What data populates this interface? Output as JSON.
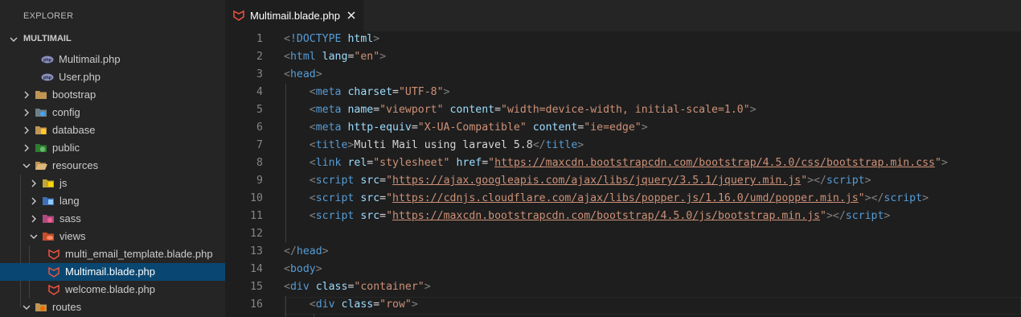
{
  "sidebar": {
    "title": "EXPLORER",
    "section": "MULTIMAIL",
    "items": [
      {
        "label": "Multimail.php",
        "icon": "php-file-icon"
      },
      {
        "label": "User.php",
        "icon": "php-file-icon"
      },
      {
        "label": "bootstrap",
        "icon": "folder-icon"
      },
      {
        "label": "config",
        "icon": "config-folder-icon"
      },
      {
        "label": "database",
        "icon": "database-folder-icon"
      },
      {
        "label": "public",
        "icon": "public-folder-icon"
      },
      {
        "label": "resources",
        "icon": "folder-open-icon"
      },
      {
        "label": "js",
        "icon": "js-folder-icon"
      },
      {
        "label": "lang",
        "icon": "lang-folder-icon"
      },
      {
        "label": "sass",
        "icon": "sass-folder-icon"
      },
      {
        "label": "views",
        "icon": "views-folder-icon"
      },
      {
        "label": "multi_email_template.blade.php",
        "icon": "blade-file-icon"
      },
      {
        "label": "Multimail.blade.php",
        "icon": "blade-file-icon"
      },
      {
        "label": "welcome.blade.php",
        "icon": "blade-file-icon"
      },
      {
        "label": "routes",
        "icon": "routes-folder-icon"
      }
    ]
  },
  "tab": {
    "label": "Multimail.blade.php"
  },
  "code": {
    "lines": [
      [
        [
          "t-punc",
          "<"
        ],
        [
          "t-tag",
          "!DOCTYPE"
        ],
        [
          "t-text",
          " "
        ],
        [
          "t-attr",
          "html"
        ],
        [
          "t-punc",
          ">"
        ]
      ],
      [
        [
          "t-punc",
          "<"
        ],
        [
          "t-tag",
          "html"
        ],
        [
          "t-text",
          " "
        ],
        [
          "t-attr",
          "lang"
        ],
        [
          "t-text",
          "="
        ],
        [
          "t-str",
          "\"en\""
        ],
        [
          "t-punc",
          ">"
        ]
      ],
      [
        [
          "t-punc",
          "<"
        ],
        [
          "t-tag",
          "head"
        ],
        [
          "t-punc",
          ">"
        ]
      ],
      [
        [
          "t-text",
          "    "
        ],
        [
          "t-punc",
          "<"
        ],
        [
          "t-tag",
          "meta"
        ],
        [
          "t-text",
          " "
        ],
        [
          "t-attr",
          "charset"
        ],
        [
          "t-text",
          "="
        ],
        [
          "t-str",
          "\"UTF-8\""
        ],
        [
          "t-punc",
          ">"
        ]
      ],
      [
        [
          "t-text",
          "    "
        ],
        [
          "t-punc",
          "<"
        ],
        [
          "t-tag",
          "meta"
        ],
        [
          "t-text",
          " "
        ],
        [
          "t-attr",
          "name"
        ],
        [
          "t-text",
          "="
        ],
        [
          "t-str",
          "\"viewport\""
        ],
        [
          "t-text",
          " "
        ],
        [
          "t-attr",
          "content"
        ],
        [
          "t-text",
          "="
        ],
        [
          "t-str",
          "\"width=device-width, initial-scale=1.0\""
        ],
        [
          "t-punc",
          ">"
        ]
      ],
      [
        [
          "t-text",
          "    "
        ],
        [
          "t-punc",
          "<"
        ],
        [
          "t-tag",
          "meta"
        ],
        [
          "t-text",
          " "
        ],
        [
          "t-attr",
          "http-equiv"
        ],
        [
          "t-text",
          "="
        ],
        [
          "t-str",
          "\"X-UA-Compatible\""
        ],
        [
          "t-text",
          " "
        ],
        [
          "t-attr",
          "content"
        ],
        [
          "t-text",
          "="
        ],
        [
          "t-str",
          "\"ie=edge\""
        ],
        [
          "t-punc",
          ">"
        ]
      ],
      [
        [
          "t-text",
          "    "
        ],
        [
          "t-punc",
          "<"
        ],
        [
          "t-tag",
          "title"
        ],
        [
          "t-punc",
          ">"
        ],
        [
          "t-text",
          "Multi Mail using laravel 5.8"
        ],
        [
          "t-punc",
          "</"
        ],
        [
          "t-tag",
          "title"
        ],
        [
          "t-punc",
          ">"
        ]
      ],
      [
        [
          "t-text",
          "    "
        ],
        [
          "t-punc",
          "<"
        ],
        [
          "t-tag",
          "link"
        ],
        [
          "t-text",
          " "
        ],
        [
          "t-attr",
          "rel"
        ],
        [
          "t-text",
          "="
        ],
        [
          "t-str",
          "\"stylesheet\""
        ],
        [
          "t-text",
          " "
        ],
        [
          "t-attr",
          "href"
        ],
        [
          "t-text",
          "="
        ],
        [
          "t-str",
          "\""
        ],
        [
          "t-str t-url",
          "https://maxcdn.bootstrapcdn.com/bootstrap/4.5.0/css/bootstrap.min.css"
        ],
        [
          "t-str",
          "\""
        ],
        [
          "t-punc",
          ">"
        ]
      ],
      [
        [
          "t-text",
          "    "
        ],
        [
          "t-punc",
          "<"
        ],
        [
          "t-tag",
          "script"
        ],
        [
          "t-text",
          " "
        ],
        [
          "t-attr",
          "src"
        ],
        [
          "t-text",
          "="
        ],
        [
          "t-str",
          "\""
        ],
        [
          "t-str t-url",
          "https://ajax.googleapis.com/ajax/libs/jquery/3.5.1/jquery.min.js"
        ],
        [
          "t-str",
          "\""
        ],
        [
          "t-punc",
          "></"
        ],
        [
          "t-tag",
          "script"
        ],
        [
          "t-punc",
          ">"
        ]
      ],
      [
        [
          "t-text",
          "    "
        ],
        [
          "t-punc",
          "<"
        ],
        [
          "t-tag",
          "script"
        ],
        [
          "t-text",
          " "
        ],
        [
          "t-attr",
          "src"
        ],
        [
          "t-text",
          "="
        ],
        [
          "t-str",
          "\""
        ],
        [
          "t-str t-url",
          "https://cdnjs.cloudflare.com/ajax/libs/popper.js/1.16.0/umd/popper.min.js"
        ],
        [
          "t-str",
          "\""
        ],
        [
          "t-punc",
          "></"
        ],
        [
          "t-tag",
          "script"
        ],
        [
          "t-punc",
          ">"
        ]
      ],
      [
        [
          "t-text",
          "    "
        ],
        [
          "t-punc",
          "<"
        ],
        [
          "t-tag",
          "script"
        ],
        [
          "t-text",
          " "
        ],
        [
          "t-attr",
          "src"
        ],
        [
          "t-text",
          "="
        ],
        [
          "t-str",
          "\""
        ],
        [
          "t-str t-url",
          "https://maxcdn.bootstrapcdn.com/bootstrap/4.5.0/js/bootstrap.min.js"
        ],
        [
          "t-str",
          "\""
        ],
        [
          "t-punc",
          "></"
        ],
        [
          "t-tag",
          "script"
        ],
        [
          "t-punc",
          ">"
        ]
      ],
      [],
      [
        [
          "t-punc",
          "</"
        ],
        [
          "t-tag",
          "head"
        ],
        [
          "t-punc",
          ">"
        ]
      ],
      [
        [
          "t-punc",
          "<"
        ],
        [
          "t-tag",
          "body"
        ],
        [
          "t-punc",
          ">"
        ]
      ],
      [
        [
          "t-punc",
          "<"
        ],
        [
          "t-tag",
          "div"
        ],
        [
          "t-text",
          " "
        ],
        [
          "t-attr",
          "class"
        ],
        [
          "t-text",
          "="
        ],
        [
          "t-str",
          "\"container\""
        ],
        [
          "t-punc",
          ">"
        ]
      ],
      [
        [
          "t-text",
          "    "
        ],
        [
          "t-punc",
          "<"
        ],
        [
          "t-tag",
          "div"
        ],
        [
          "t-text",
          " "
        ],
        [
          "t-attr",
          "class"
        ],
        [
          "t-text",
          "="
        ],
        [
          "t-str",
          "\"row\""
        ],
        [
          "t-punc",
          ">"
        ]
      ]
    ]
  },
  "colors": {
    "accent_selected": "#094771",
    "background": "#1e1e1e",
    "sidebar": "#252526"
  }
}
